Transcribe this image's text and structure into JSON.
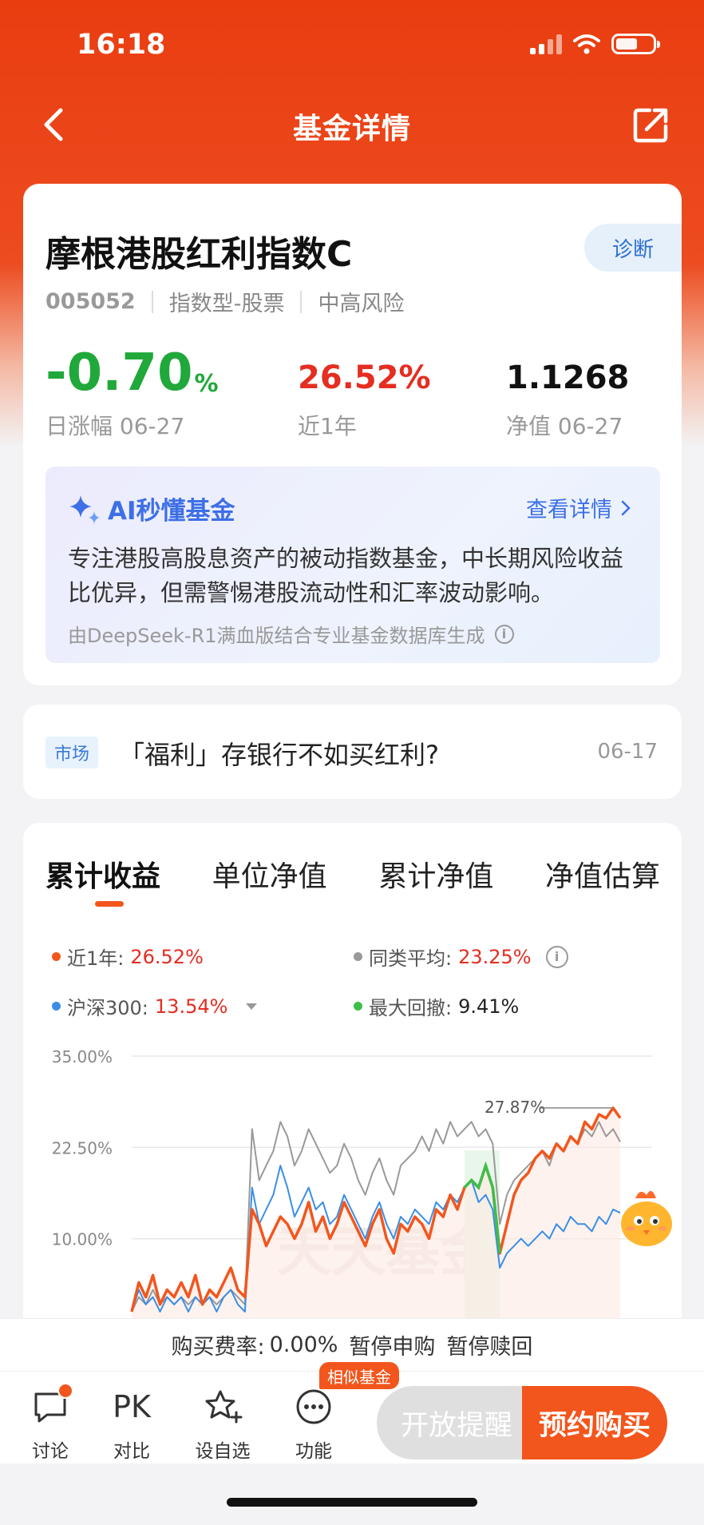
{
  "status": {
    "time": "16:18"
  },
  "nav": {
    "title": "基金详情"
  },
  "fund": {
    "name": "摩根港股红利指数C",
    "code": "005052",
    "type": "指数型-股票",
    "risk": "中高风险",
    "diagnose_label": "诊断",
    "daily_change": "-0.70",
    "daily_change_unit": "%",
    "daily_change_label": "日涨幅 06-27",
    "year_return": "26.52%",
    "year_return_label": "近1年",
    "nav_value": "1.1268",
    "nav_label": "净值 06-27"
  },
  "ai": {
    "title": "AI秒懂基金",
    "more": "查看详情",
    "text": "专注港股高股息资产的被动指数基金，中长期风险收益比优异，但需警惕港股流动性和汇率波动影响。",
    "footer": "由DeepSeek-R1满血版结合专业基金数据库生成"
  },
  "news": {
    "tag": "市场",
    "title": "「福利」存银行不如买红利?",
    "date": "06-17"
  },
  "tabs": [
    "累计收益",
    "单位净值",
    "累计净值",
    "净值估算"
  ],
  "legend": {
    "fund_label": "近1年:",
    "fund_value": "26.52%",
    "peer_label": "同类平均:",
    "peer_value": "23.25%",
    "index_label": "沪深300:",
    "index_value": "13.54%",
    "drawdown_label": "最大回撤:",
    "drawdown_value": "9.41%"
  },
  "colors": {
    "brand": "#f2561d",
    "up": "#e52d21",
    "down": "#20a83a",
    "link": "#3d6fe6",
    "peer": "#999999",
    "index": "#3a8ee6",
    "drawdown": "#3cbf4a"
  },
  "chart_data": {
    "type": "line",
    "y_ticks": [
      "35.00%",
      "22.50%",
      "10.00%"
    ],
    "ylim": [
      0,
      35
    ],
    "grid": true,
    "annotation": "27.87%",
    "watermark": "天天基金",
    "series": [
      {
        "name": "近1年",
        "values": [
          0,
          4,
          2,
          5,
          1,
          3,
          2,
          4,
          2,
          5,
          1,
          3,
          2,
          4,
          6,
          3,
          2,
          14,
          12,
          9,
          11,
          13,
          12,
          10,
          12,
          15,
          11,
          13,
          10,
          12,
          15,
          13,
          11,
          9,
          12,
          14,
          10,
          8,
          12,
          11,
          13,
          12,
          10,
          14,
          13,
          16,
          14,
          17,
          18,
          17,
          20,
          17,
          8,
          12,
          16,
          18,
          19,
          21,
          22,
          21,
          23,
          22,
          24,
          23,
          26,
          25,
          27,
          26.5,
          27.9,
          26.52
        ]
      },
      {
        "name": "同类平均",
        "values": [
          0,
          2,
          1,
          3,
          1,
          2,
          1,
          2,
          1,
          2,
          1,
          2,
          1,
          2,
          3,
          2,
          1,
          25,
          18,
          20,
          22,
          26,
          24,
          20,
          22,
          25,
          23,
          21,
          19,
          20,
          23,
          21,
          18,
          16,
          19,
          21,
          18,
          16,
          20,
          21,
          22,
          24,
          22,
          25,
          23,
          26,
          24,
          25,
          26,
          24,
          25,
          23,
          12,
          16,
          18,
          19,
          20,
          21,
          22,
          20,
          23,
          22,
          24,
          23,
          25,
          24,
          26,
          24,
          25,
          23.25
        ]
      },
      {
        "name": "沪深300",
        "values": [
          0,
          3,
          1,
          2,
          0,
          2,
          1,
          2,
          0,
          2,
          1,
          2,
          0,
          2,
          3,
          1,
          0,
          17,
          12,
          14,
          16,
          20,
          17,
          13,
          15,
          17,
          14,
          15,
          12,
          13,
          16,
          14,
          12,
          10,
          13,
          15,
          12,
          10,
          13,
          12,
          14,
          13,
          12,
          15,
          14,
          16,
          15,
          17,
          18,
          15,
          16,
          14,
          6,
          8,
          9,
          10,
          9,
          10,
          11,
          10,
          12,
          11,
          13,
          12,
          12,
          11,
          13,
          12,
          14,
          13.54
        ]
      }
    ],
    "drawdown": {
      "value": "9.41%"
    }
  },
  "bottom": {
    "fee_label": "购买费率:",
    "fee_value": "0.00%",
    "subscribe_status": "暂停申购",
    "redeem_status": "暂停赎回",
    "items": [
      {
        "label": "讨论",
        "icon": "chat-icon"
      },
      {
        "label": "对比",
        "icon": "pk-icon",
        "glyph": "PK"
      },
      {
        "label": "设自选",
        "icon": "star-add-icon"
      },
      {
        "label": "功能",
        "icon": "more-icon"
      }
    ],
    "similar_badge": "相似基金",
    "remind_label": "开放提醒",
    "buy_label": "预约购买"
  }
}
